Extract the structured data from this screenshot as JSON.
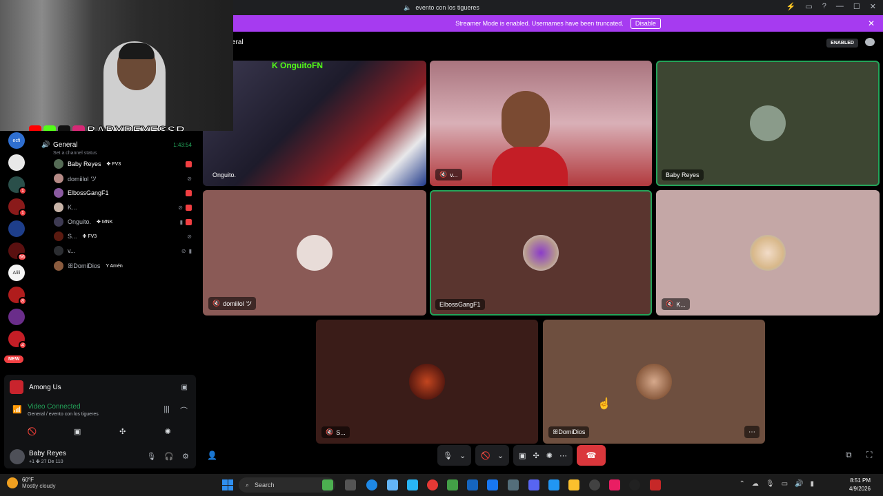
{
  "window": {
    "title": "evento con los tigueres"
  },
  "banner": {
    "text": "Streamer Mode is enabled. Usernames have been truncated.",
    "disable_label": "Disable"
  },
  "webcam": {
    "social_handle": "BABYREYESSR"
  },
  "servers": [
    {
      "label": "ecfi",
      "badge": ""
    },
    {
      "label": "",
      "badge": ""
    },
    {
      "label": "",
      "badge": "1"
    },
    {
      "label": "",
      "badge": "1"
    },
    {
      "label": "",
      "badge": ""
    },
    {
      "label": "",
      "badge": "56"
    },
    {
      "label": "Alili",
      "badge": ""
    },
    {
      "label": "",
      "badge": "8"
    },
    {
      "label": "",
      "badge": ""
    },
    {
      "label": "",
      "badge": "4"
    }
  ],
  "new_badge": "NEW",
  "channel": {
    "name": "General",
    "timer": "1:43:54",
    "status_placeholder": "Set a channel status",
    "members": [
      {
        "name": "Baby Reyes",
        "tag": "✤ FV3"
      },
      {
        "name": "domiilol ツ",
        "tag": ""
      },
      {
        "name": "ElbossGangF1",
        "tag": ""
      },
      {
        "name": "K...",
        "tag": ""
      },
      {
        "name": "Onguito.",
        "tag": "✤ MNK"
      },
      {
        "name": "S...",
        "tag": "✤ FV3"
      },
      {
        "name": "v...",
        "tag": ""
      },
      {
        "name": "ꕥDomiDios",
        "tag": "Y Amén"
      }
    ]
  },
  "voice_panel": {
    "activity": "Among Us",
    "status": "Video Connected",
    "location": "General / evento con los tigueres",
    "user_name": "Baby Reyes",
    "user_sub": "+1 ✤ 27 De 110"
  },
  "main": {
    "crumb": "eral",
    "enabled_label": "ENABLED",
    "tiles": [
      {
        "name": "Onguito.",
        "overlay": "K OnguitoFN",
        "type": "video",
        "bg": "#2a2438"
      },
      {
        "name": "v...",
        "type": "video",
        "bg": "#c28a8f"
      },
      {
        "name": "Baby Reyes",
        "type": "avatar",
        "bg": "#3d4632",
        "speaking": true
      },
      {
        "name": "domiilol ツ",
        "type": "avatar",
        "bg": "#8a5a56"
      },
      {
        "name": "ElbossGangF1",
        "type": "avatar",
        "bg": "#5a352f",
        "speaking": true
      },
      {
        "name": "K...",
        "type": "avatar",
        "bg": "#c4a7a6"
      },
      {
        "name": "S...",
        "type": "avatar",
        "bg": "#3a1c18"
      },
      {
        "name": "ꕥDomiDios",
        "type": "avatar",
        "bg": "#6e4f3f"
      }
    ]
  },
  "taskbar": {
    "temp": "60°F",
    "weather": "Mostly cloudy",
    "search_placeholder": "Search",
    "time": "8:51 PM",
    "date": "4/9/2026"
  },
  "colors": {
    "streamer_banner": "#a63bf0",
    "speaking_outline": "#23a55a",
    "hangup": "#da373c",
    "video_connected": "#23a55a"
  }
}
